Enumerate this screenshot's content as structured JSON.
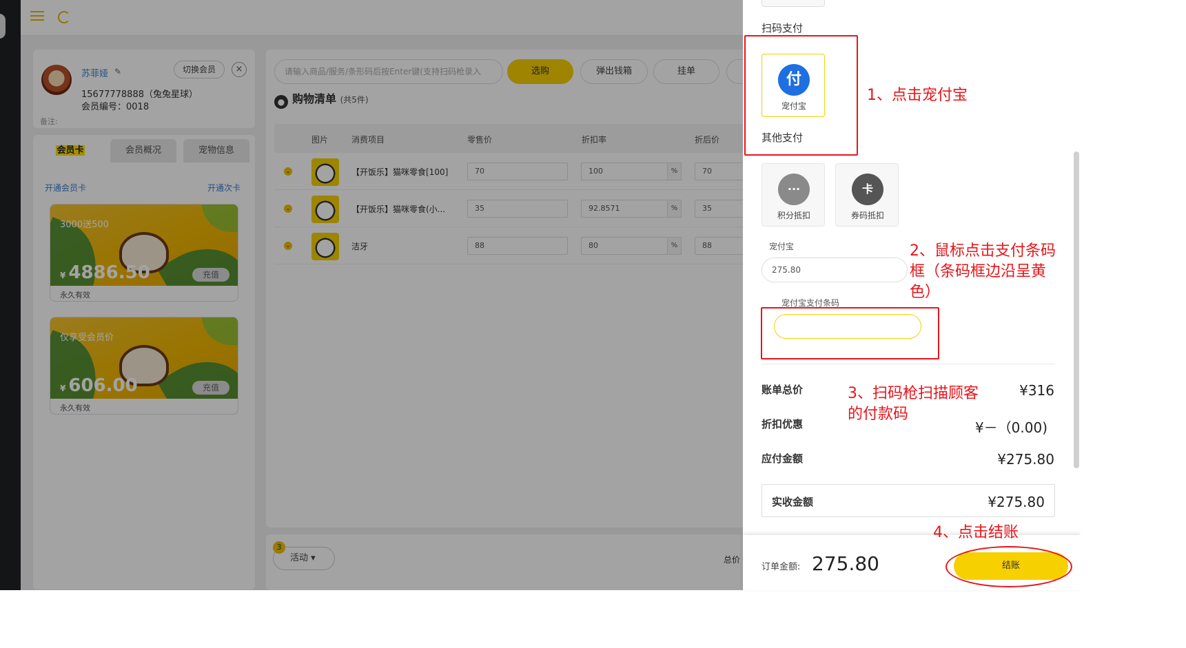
{
  "member": {
    "name": "苏菲娅",
    "phone": "15677778888（兔兔星球）",
    "number": "会员编号：0018",
    "note": "备注:",
    "switch_label": "切换会员",
    "close_label": "×"
  },
  "member_tabs": [
    "会员卡",
    "会员概况",
    "宠物信息"
  ],
  "cards_panel": {
    "open_card": "开通会员卡",
    "open_times": "开通次卡",
    "cards": [
      {
        "name": "3000送500",
        "currency": "¥",
        "amount": "4886.50",
        "recharge": "充值",
        "validity": "永久有效"
      },
      {
        "name": "仅享受会员价",
        "currency": "¥",
        "amount": "606.00",
        "recharge": "充值",
        "validity": "永久有效"
      }
    ]
  },
  "toolbar": {
    "search_placeholder": "请输入商品/服务/条形码后按Enter键(支持扫码枪录入",
    "buttons": [
      "选购",
      "弹出钱箱",
      "挂单"
    ]
  },
  "cart": {
    "title": "购物清单",
    "count": "(共5件)",
    "columns": [
      "图片",
      "消费项目",
      "零售价",
      "折扣率",
      "折后价"
    ],
    "rows": [
      {
        "name": "【开饭乐】猫咪零食[100]",
        "retail": "70",
        "rate": "100",
        "final": "70"
      },
      {
        "name": "【开饭乐】猫咪零食(小...",
        "retail": "35",
        "rate": "92.8571",
        "final": "35"
      },
      {
        "name": "洁牙",
        "retail": "88",
        "rate": "80",
        "final": "88"
      }
    ],
    "percent": "%"
  },
  "bottom": {
    "badge": "3",
    "activity": "活动",
    "total_label": "总价"
  },
  "drawer": {
    "scan_pay_title": "扫码支付",
    "other_pay_title": "其他支付",
    "scan_methods": [
      {
        "label": "宠付宝",
        "glyph": "付",
        "color": "#1e6fe0"
      }
    ],
    "other_methods": [
      {
        "label": "积分抵扣",
        "glyph": "···",
        "color": "#8a8a8a"
      },
      {
        "label": "券码抵扣",
        "glyph": "卡",
        "color": "#555555"
      }
    ],
    "amount_label": "宠付宝",
    "amount_value": "275.80",
    "barcode_label": "宠付宝支付条码",
    "summary": [
      {
        "label": "账单总价",
        "value": "¥316"
      },
      {
        "label": "折扣优惠",
        "value": "¥－（0.00)"
      },
      {
        "label": "应付金额",
        "value": "¥275.80"
      }
    ],
    "received_label": "实收金额",
    "received_value": "¥275.80",
    "order_label": "订单金额:",
    "order_amount": "275.80",
    "checkout_label": "结账"
  },
  "annotations": [
    "1、点击宠付宝",
    "2、鼠标点击支付条码框（条码框边沿呈黄色）",
    "3、扫码枪扫描顾客的付款码",
    "4、点击结账"
  ],
  "colors": {
    "accent": "#f7d000",
    "annotation": "#e8141a",
    "link": "#3a7bd5"
  }
}
